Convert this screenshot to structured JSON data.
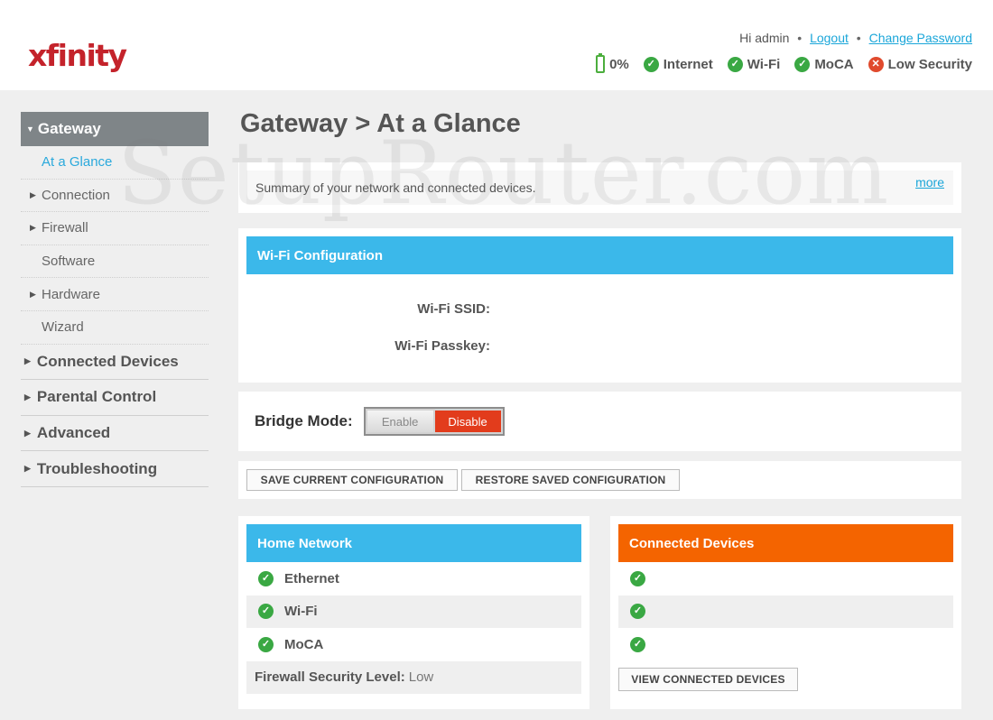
{
  "header": {
    "logo_text": "xfinity",
    "greeting": "Hi admin",
    "logout_label": "Logout",
    "change_password_label": "Change Password",
    "status": {
      "battery": "0%",
      "internet": "Internet",
      "wifi": "Wi-Fi",
      "moca": "MoCA",
      "security": "Low Security"
    }
  },
  "sidebar": {
    "gateway_label": "Gateway",
    "gateway_items": [
      {
        "label": "At a Glance"
      },
      {
        "label": "Connection"
      },
      {
        "label": "Firewall"
      },
      {
        "label": "Software"
      },
      {
        "label": "Hardware"
      },
      {
        "label": "Wizard"
      }
    ],
    "main_items": [
      {
        "label": "Connected Devices"
      },
      {
        "label": "Parental Control"
      },
      {
        "label": "Advanced"
      },
      {
        "label": "Troubleshooting"
      }
    ]
  },
  "main": {
    "title": "Gateway > At a Glance",
    "summary_text": "Summary of your network and connected devices.",
    "more_label": "more",
    "wifi_config": {
      "title": "Wi-Fi Configuration",
      "ssid_label": "Wi-Fi SSID:",
      "passkey_label": "Wi-Fi Passkey:"
    },
    "bridge_mode": {
      "label": "Bridge Mode:",
      "enable_label": "Enable",
      "disable_label": "Disable"
    },
    "save_config_label": "SAVE CURRENT CONFIGURATION",
    "restore_config_label": "RESTORE SAVED CONFIGURATION",
    "home_network": {
      "title": "Home Network",
      "items": [
        {
          "label": "Ethernet"
        },
        {
          "label": "Wi-Fi"
        },
        {
          "label": "MoCA"
        }
      ],
      "firewall_label": "Firewall Security Level:",
      "firewall_value": "Low"
    },
    "connected_devices": {
      "title": "Connected Devices",
      "view_label": "VIEW CONNECTED DEVICES"
    }
  },
  "watermark_text": "SetupRouter.com",
  "colors": {
    "brand_red": "#c4232b",
    "accent_blue": "#3bb8ea",
    "accent_orange": "#f46400",
    "ok_green": "#3aa843",
    "danger_red": "#e23c1c"
  }
}
